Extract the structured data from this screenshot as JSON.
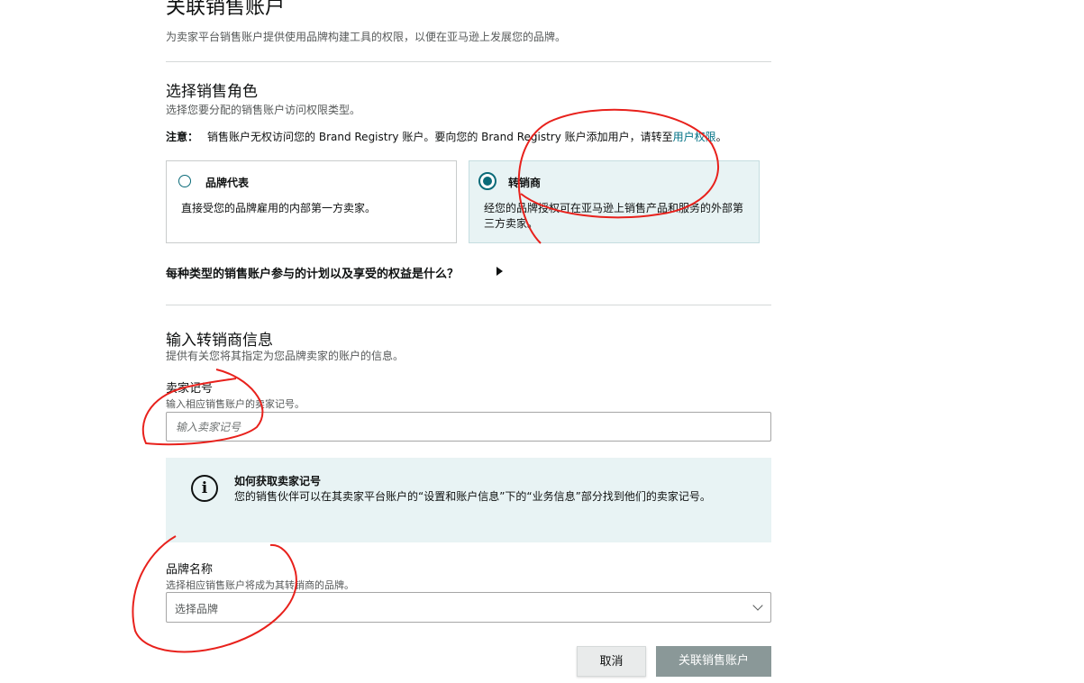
{
  "header": {
    "title": "关联销售账户",
    "subtitle": "为卖家平台销售账户提供使用品牌构建工具的权限，以便在亚马逊上发展您的品牌。"
  },
  "role_section": {
    "title": "选择销售角色",
    "description": "选择您要分配的销售账户访问权限类型。",
    "note_label": "注意：",
    "note_text": "销售账户无权访问您的 Brand Registry 账户。要向您的 Brand Registry 账户添加用户，请转至",
    "note_link": "用户权限",
    "note_end": "。",
    "options": [
      {
        "label": "品牌代表",
        "description": "直接受您的品牌雇用的内部第一方卖家。",
        "selected": false
      },
      {
        "label": "转销商",
        "description": "经您的品牌授权可在亚马逊上销售产品和服务的外部第三方卖家。",
        "selected": true
      }
    ],
    "faq": "每种类型的销售账户参与的计划以及享受的权益是什么？"
  },
  "reseller_section": {
    "title": "输入转销商信息",
    "description": "提供有关您将其指定为您品牌卖家的账户的信息。",
    "seller_id": {
      "label": "卖家记号",
      "hint": "输入相应销售账户的卖家记号。",
      "placeholder": "输入卖家记号",
      "value": ""
    },
    "info": {
      "title": "如何获取卖家记号",
      "text": "您的销售伙伴可以在其卖家平台账户的“设置和账户信息”下的“业务信息”部分找到他们的卖家记号。"
    },
    "brand": {
      "label": "品牌名称",
      "hint": "选择相应销售账户将成为其转销商的品牌。",
      "selected": "选择品牌"
    }
  },
  "actions": {
    "cancel": "取消",
    "submit": "关联销售账户"
  },
  "colors": {
    "accent": "#0b6b79",
    "selected_bg": "#e8f3f4",
    "annotation": "#e8211c",
    "link": "#007185"
  },
  "icons": {
    "info": "info-circle-icon",
    "expand": "triangle-right-icon",
    "dropdown": "chevron-down-icon"
  }
}
